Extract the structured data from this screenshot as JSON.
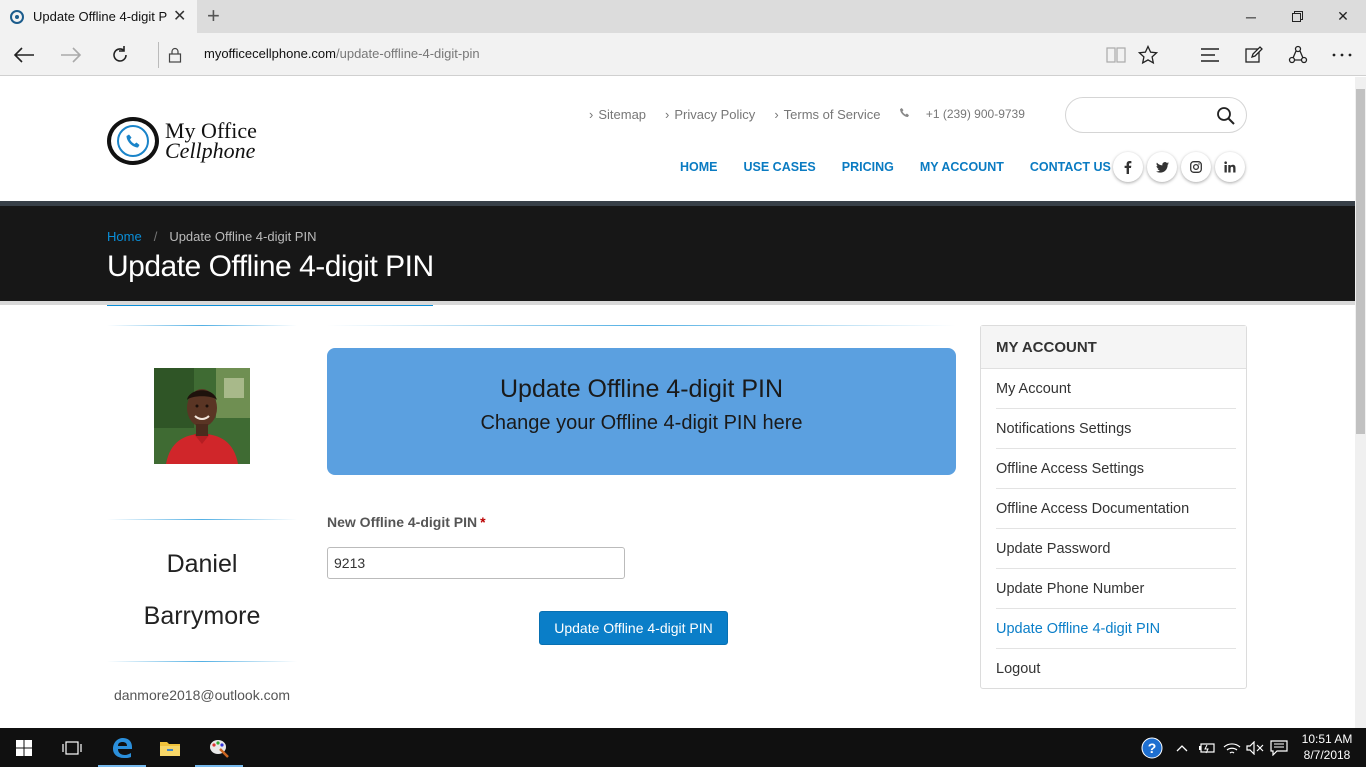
{
  "browser": {
    "tab_title": "Update Offline 4-digit P",
    "new_tab_symbol": "+",
    "url_domain": "myofficecellphone.com",
    "url_path": "/update-offline-4-digit-pin"
  },
  "site": {
    "logo_line1": "My Office",
    "logo_line2": "Cellphone",
    "top_links": [
      "Sitemap",
      "Privacy Policy",
      "Terms of Service"
    ],
    "phone": "+1 (239) 900-9739",
    "search_placeholder": "",
    "nav": [
      "HOME",
      "USE CASES",
      "PRICING",
      "MY ACCOUNT",
      "CONTACT US"
    ],
    "social": [
      "f",
      "t",
      "ig",
      "in"
    ],
    "accent_color": "#0a8ed8"
  },
  "page": {
    "breadcrumb_home": "Home",
    "breadcrumb_sep": "/",
    "breadcrumb_current": "Update Offline 4-digit PIN",
    "title": "Update Offline 4-digit PIN"
  },
  "profile": {
    "first_name": "Daniel",
    "last_name": "Barrymore",
    "email": "danmore2018@outlook.com"
  },
  "hero": {
    "title": "Update Offline 4-digit PIN",
    "subtitle": "Change your Offline 4-digit PIN here"
  },
  "form": {
    "label": "New Offline 4-digit PIN",
    "required_mark": "*",
    "value": "9213",
    "submit_label": "Update Offline 4-digit PIN"
  },
  "account_menu": {
    "heading": "MY ACCOUNT",
    "items": [
      "My Account",
      "Notifications Settings",
      "Offline Access Settings",
      "Offline Access Documentation",
      "Update Password",
      "Update Phone Number",
      "Update Offline 4-digit PIN",
      "Logout"
    ],
    "active_index": 6
  },
  "taskbar": {
    "time": "10:51 AM",
    "date": "8/7/2018"
  }
}
